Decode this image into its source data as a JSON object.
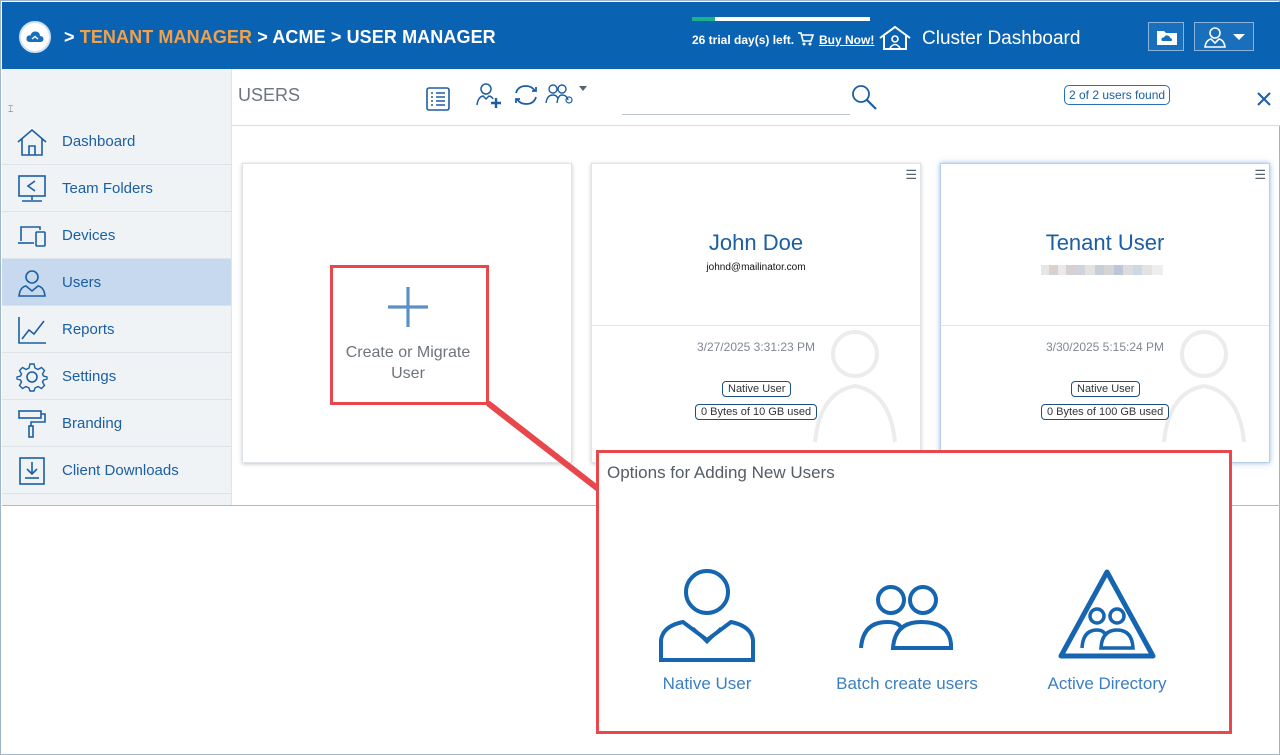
{
  "header": {
    "breadcrumb_prefix": ">",
    "tenant_manager": "TENANT MANAGER",
    "sep1": ">",
    "acme": "ACME",
    "sep2": ">",
    "user_manager": "USER MANAGER",
    "trial_text": "26 trial day(s) left.",
    "buy_now": "Buy Now!",
    "cluster_dashboard": "Cluster Dashboard",
    "trial_progress": 0.13,
    "colors": {
      "bar": "#0a62b3",
      "tenant": "#f0a14a",
      "trial_fill": "#1ab28a"
    }
  },
  "sidebar": {
    "collapse_icon": "collapse-icon",
    "items": [
      {
        "label": "Dashboard",
        "icon": "home-icon",
        "active": false
      },
      {
        "label": "Team Folders",
        "icon": "team-folder-icon",
        "active": false
      },
      {
        "label": "Devices",
        "icon": "devices-icon",
        "active": false
      },
      {
        "label": "Users",
        "icon": "users-icon",
        "active": true
      },
      {
        "label": "Reports",
        "icon": "reports-icon",
        "active": false
      },
      {
        "label": "Settings",
        "icon": "gear-icon",
        "active": false
      },
      {
        "label": "Branding",
        "icon": "paint-roller-icon",
        "active": false
      },
      {
        "label": "Client Downloads",
        "icon": "download-icon",
        "active": false
      }
    ]
  },
  "toolbar": {
    "title": "USERS",
    "search_placeholder": "",
    "found": "2 of 2 users found"
  },
  "cards": {
    "create": {
      "label_line1": "Create or Migrate",
      "label_line2": "User"
    },
    "users": [
      {
        "name": "John Doe",
        "email": "johnd@mailinator.com",
        "date": "3/27/2025 3:31:23 PM",
        "type": "Native User",
        "usage": "0 Bytes of 10 GB used"
      },
      {
        "name": "Tenant User",
        "email": "",
        "date": "3/30/2025 5:15:24 PM",
        "type": "Native User",
        "usage": "0 Bytes of 100 GB used"
      }
    ]
  },
  "options": {
    "title": "Options for Adding New Users",
    "items": [
      {
        "label": "Native User",
        "icon": "native-user-icon"
      },
      {
        "label": "Batch create users",
        "icon": "batch-users-icon"
      },
      {
        "label": "Active Directory",
        "icon": "active-directory-icon"
      }
    ]
  }
}
